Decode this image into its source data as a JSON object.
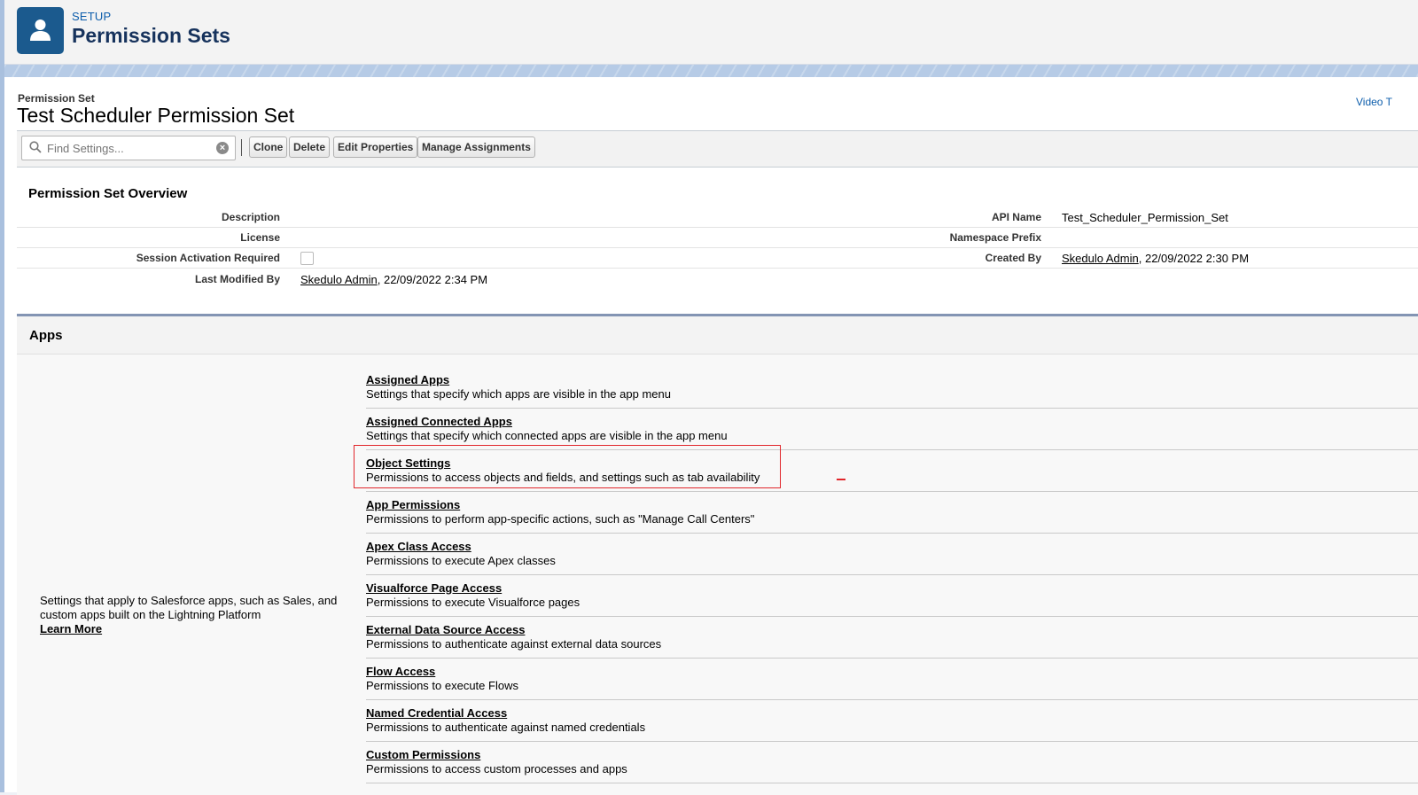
{
  "header": {
    "setup_label": "SETUP",
    "title": "Permission Sets",
    "icon": "user-icon",
    "icon_color": "#1b5a8e"
  },
  "record": {
    "type_label": "Permission Set",
    "title": "Test Scheduler Permission Set",
    "video_link": "Video T"
  },
  "toolbar": {
    "search_placeholder": "Find Settings...",
    "buttons": [
      "Clone",
      "Delete",
      "Edit Properties",
      "Manage Assignments"
    ]
  },
  "overview": {
    "title": "Permission Set Overview",
    "description_label": "Description",
    "license_label": "License",
    "session_label": "Session Activation Required",
    "session_checked": false,
    "last_modified_label": "Last Modified By",
    "last_modified_user": "Skedulo Admin",
    "last_modified_date": ", 22/09/2022 2:34 PM",
    "api_name_label": "API Name",
    "api_name_value": "Test_Scheduler_Permission_Set",
    "namespace_label": "Namespace Prefix",
    "created_by_label": "Created By",
    "created_by_user": "Skedulo Admin",
    "created_by_date": ", 22/09/2022 2:30 PM"
  },
  "apps": {
    "title": "Apps",
    "description": "Settings that apply to Salesforce apps, such as Sales, and custom apps built on the Lightning Platform",
    "learn_more": "Learn More",
    "items": [
      {
        "title": "Assigned Apps",
        "desc": "Settings that specify which apps are visible in the app menu"
      },
      {
        "title": "Assigned Connected Apps",
        "desc": "Settings that specify which connected apps are visible in the app menu"
      },
      {
        "title": "Object Settings",
        "desc": "Permissions to access objects and fields, and settings such as tab availability"
      },
      {
        "title": "App Permissions",
        "desc": "Permissions to perform app-specific actions, such as \"Manage Call Centers\""
      },
      {
        "title": "Apex Class Access",
        "desc": "Permissions to execute Apex classes"
      },
      {
        "title": "Visualforce Page Access",
        "desc": "Permissions to execute Visualforce pages"
      },
      {
        "title": "External Data Source Access",
        "desc": "Permissions to authenticate against external data sources"
      },
      {
        "title": "Flow Access",
        "desc": "Permissions to execute Flows"
      },
      {
        "title": "Named Credential Access",
        "desc": "Permissions to authenticate against named credentials"
      },
      {
        "title": "Custom Permissions",
        "desc": "Permissions to access custom processes and apps"
      }
    ],
    "highlight_color": "#e1262b"
  }
}
